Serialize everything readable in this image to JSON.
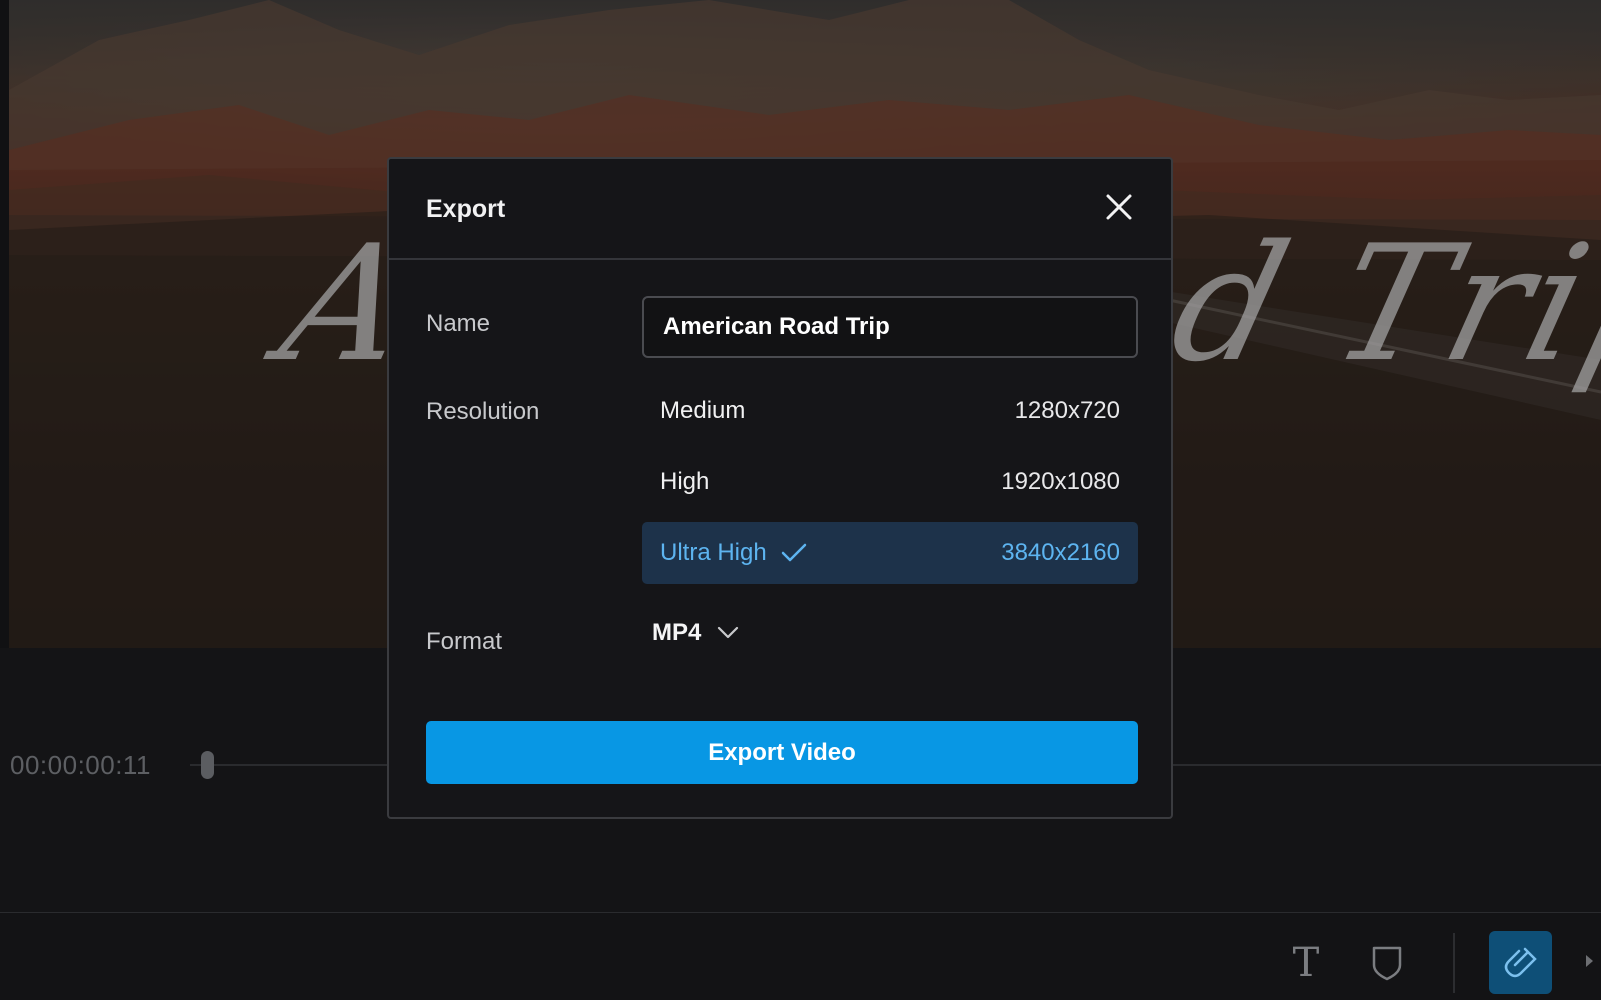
{
  "preview": {
    "title_left": "A",
    "title_right": "d Trip"
  },
  "timeline": {
    "timecode": "00:00:00:11"
  },
  "toolbar": {
    "icons": [
      "text-icon",
      "shield-icon",
      "magnet-icon"
    ]
  },
  "dialog": {
    "title": "Export",
    "name_label": "Name",
    "name_value": "American Road Trip",
    "resolution_label": "Resolution",
    "resolutions": [
      {
        "label": "Medium",
        "value": "1280x720",
        "selected": false
      },
      {
        "label": "High",
        "value": "1920x1080",
        "selected": false
      },
      {
        "label": "Ultra High",
        "value": "3840x2160",
        "selected": true
      }
    ],
    "format_label": "Format",
    "format_value": "MP4",
    "export_button": "Export Video"
  },
  "colors": {
    "accent": "#0897e4",
    "selected_bg": "#1d324a",
    "selected_text": "#5db4f0"
  }
}
